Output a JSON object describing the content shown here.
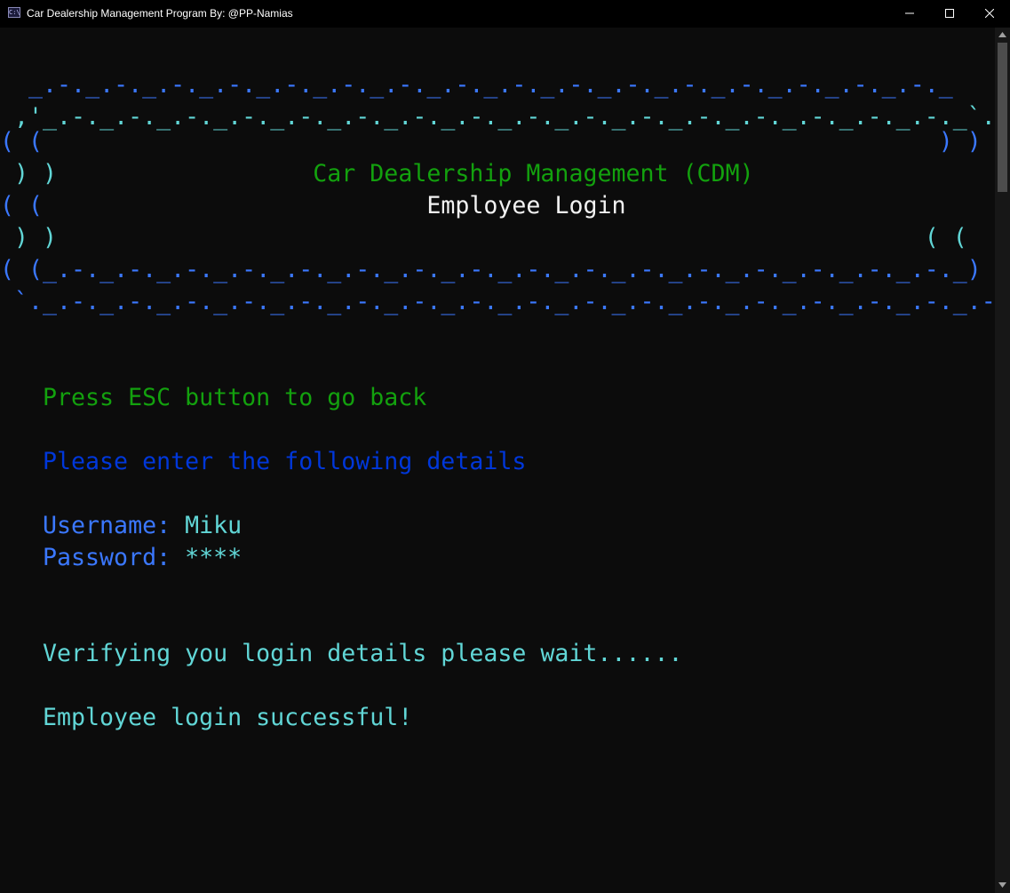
{
  "window": {
    "title": "Car Dealership Management Program By: @PP-Namias",
    "icon_name": "console-app-icon",
    "icon_glyph": "C:\\"
  },
  "banner": {
    "line1": "  _.-._.-._.-._.-._.-._.-._.-._.-._.-._.-._.-._.-._.-._.-._.-._.-._",
    "line2": " ,'_.-._.-._.-._.-._.-._.-._.-._.-._.-._.-._.-._.-._.-._.-._.-._.-._`.",
    "line3": "( (                                                               ) )",
    "line4_left": " ) )",
    "title": "Car Dealership Management (CDM)",
    "line4_right": "( (",
    "line5_left": "( (",
    "subtitle": "Employee Login",
    "line5_right": ") )",
    "line6": " ) )                                                             ( (",
    "line7": "( (_.-._.-._.-._.-._.-._.-._.-._.-._.-._.-._.-._.-._.-._.-._.-._.-._) )",
    "line8": " `._.-._.-._.-._.-._.-._.-._.-._.-._.-._.-._.-._.-._.-._.-._.-._.-._.-'"
  },
  "console": {
    "esc_hint": "Press ESC button to go back",
    "prompt": "Please enter the following details",
    "username_label": "Username:",
    "username_value": "Miku",
    "password_label": "Password:",
    "password_value": "****",
    "verifying": "Verifying you login details please wait......",
    "success": "Employee login successful!"
  },
  "colors": {
    "background": "#0c0c0c",
    "cyan": "#61d6d6",
    "blue": "#3b78ff",
    "dark_blue": "#0037da",
    "green": "#13a10e",
    "white": "#f2f2f2"
  }
}
